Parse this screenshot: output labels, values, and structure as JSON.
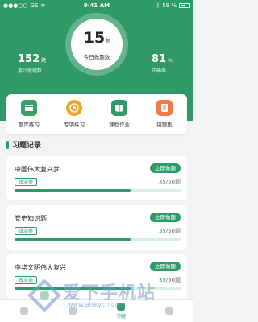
{
  "status_bar": {
    "carrier": "GS",
    "time": "9:41 AM",
    "battery": "58 %"
  },
  "today": {
    "count": "15",
    "unit": "题",
    "label": "今日做题数"
  },
  "stats": {
    "total": {
      "value": "152",
      "unit": "题",
      "label": "累计做题数"
    },
    "accuracy": {
      "value": "81",
      "unit": "%",
      "label": "正确率"
    }
  },
  "quick_actions": [
    {
      "label": "题库练习",
      "icon": "question-bank-icon",
      "color": "#3aa06b"
    },
    {
      "label": "专项练习",
      "icon": "target-icon",
      "color": "#f0a430"
    },
    {
      "label": "课程作业",
      "icon": "book-icon",
      "color": "#2f9a68"
    },
    {
      "label": "错题集",
      "icon": "error-book-icon",
      "color": "#f07a4a"
    }
  ],
  "section": {
    "title": "习题记录"
  },
  "records": [
    {
      "title": "中国伟大复兴梦",
      "button": "立即做题",
      "tag": "政治类",
      "done": "35",
      "total": "/50题",
      "progress": 0.7
    },
    {
      "title": "党史知识题",
      "button": "立即做题",
      "tag": "政治类",
      "done": "35",
      "total": "/50题",
      "progress": 0.7
    },
    {
      "title": "中华文明伟大复兴",
      "button": "立即做题",
      "tag": "政治类",
      "done": "35",
      "total": "/50题",
      "progress": 0.7
    }
  ],
  "tabbar": {
    "active_label": "习题"
  },
  "watermark": {
    "text": "爱下手机站",
    "url": "www.aiskycn.com"
  }
}
